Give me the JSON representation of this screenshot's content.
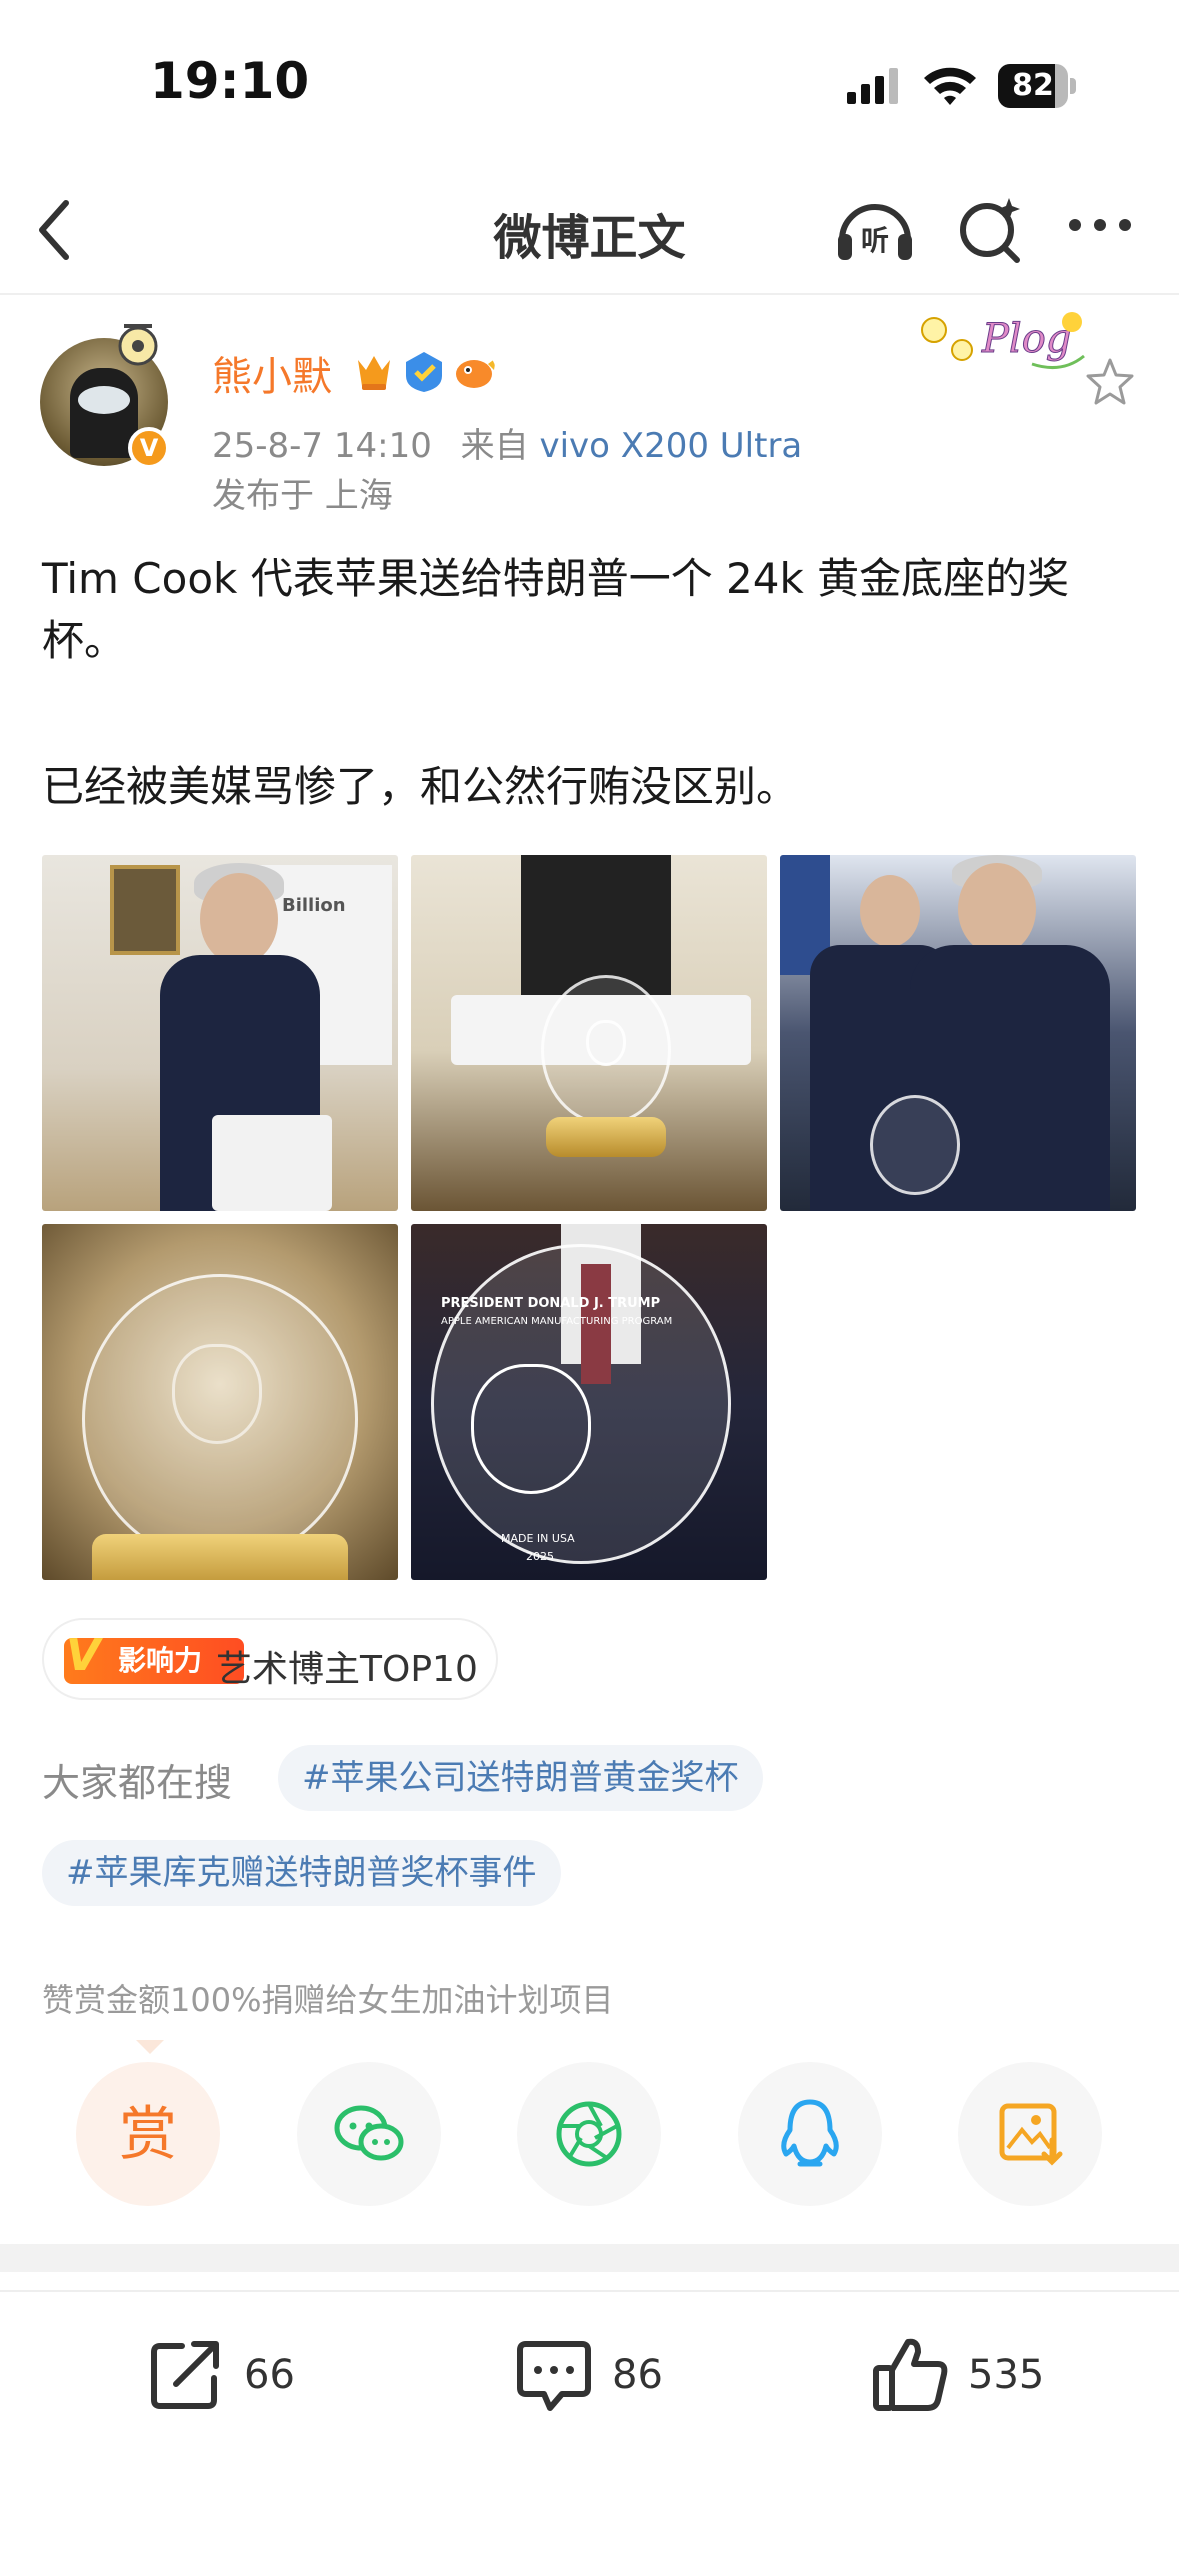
{
  "status_bar": {
    "time": "19:10",
    "battery": "82",
    "battery_level_pct": 82
  },
  "nav": {
    "title": "微博正文",
    "listen_label": "听"
  },
  "author": {
    "name": "熊小默",
    "verified_mark": "V",
    "timestamp": "25-8-7 14:10",
    "source_prefix": "来自",
    "device": "vivo X200 Ultra",
    "location": "发布于 上海"
  },
  "post": {
    "paragraph1": "Tim Cook 代表苹果送给特朗普一个 24k 黄金底座的奖杯。",
    "paragraph2": "已经被美媒骂惨了，和公然行贿没区别。"
  },
  "images": {
    "img1_text": "Billion",
    "img5_line1": "PRESIDENT DONALD J. TRUMP",
    "img5_line2": "APPLE AMERICAN MANUFACTURING PROGRAM",
    "img5_made": "MADE IN USA",
    "img5_year": "2025"
  },
  "influence": {
    "tag": "影响力",
    "tag_v": "V",
    "label": "艺术博主TOP10"
  },
  "hot_search": {
    "label": "大家都在搜",
    "tags": [
      "#苹果公司送特朗普黄金奖杯",
      "#苹果库克赠送特朗普奖杯事件"
    ]
  },
  "donate_note": "赞赏金额100%捐赠给女生加油计划项目",
  "share": {
    "reward_label": "赏"
  },
  "actions": {
    "repost_count": "66",
    "comment_count": "86",
    "like_count": "535"
  },
  "colors": {
    "accent_orange": "#f5782a",
    "link_blue": "#4b7bb3",
    "wechat_green": "#2bbf6a",
    "qq_blue": "#2aa6f0",
    "save_orange": "#f5a623"
  }
}
